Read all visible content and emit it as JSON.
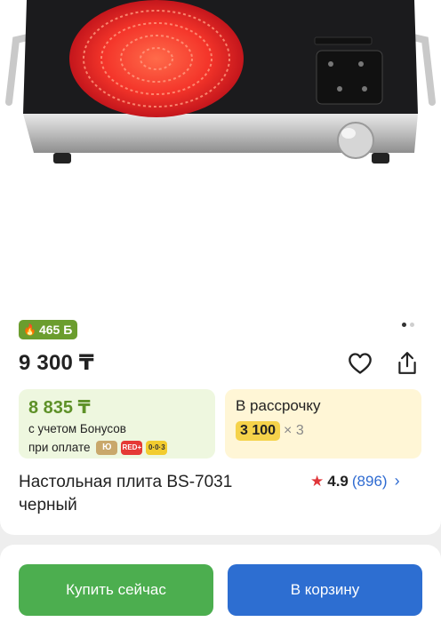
{
  "gallery": {
    "image_alt": "Настольная плита BS-7031 черный",
    "page_count": 2,
    "active_page": 1
  },
  "bonus_badge": {
    "label": "465 Б"
  },
  "price": {
    "value": "9 300 ₸"
  },
  "bonus_box": {
    "amount": "8 835 ₸",
    "line1": "с учетом Бонусов",
    "line2": "при оплате",
    "chips": [
      "Ю",
      "RED+",
      "0·0·3"
    ]
  },
  "installment_box": {
    "label": "В рассрочку",
    "amount": "3 100",
    "multiplier": "× 3"
  },
  "product": {
    "title": "Настольная плита BS-7031 черный"
  },
  "rating": {
    "value": "4.9",
    "count": "(896)"
  },
  "actions": {
    "buy_now": "Купить сейчас",
    "add_to_cart": "В корзину"
  },
  "colors": {
    "buy": "#4cae4f",
    "cart": "#2d6ed1",
    "bonus_green": "#6b9d2e",
    "star": "#e0363a"
  }
}
